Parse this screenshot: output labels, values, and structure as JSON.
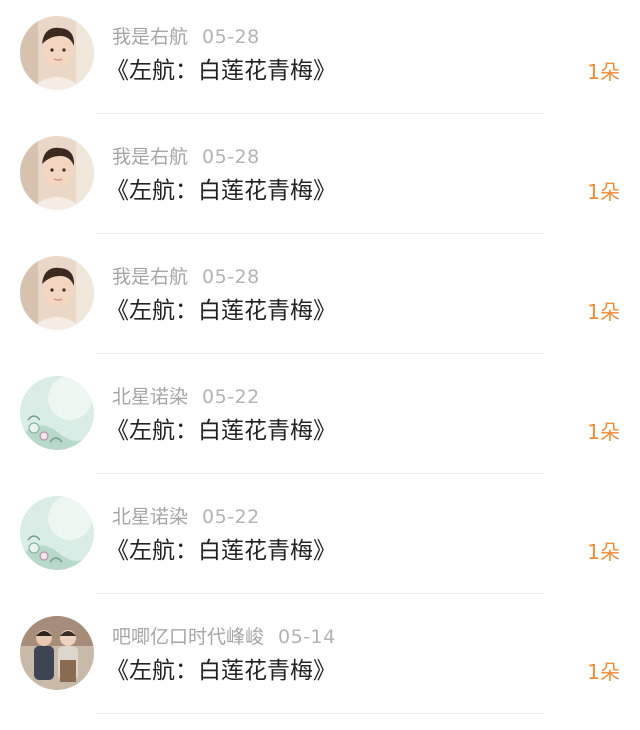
{
  "items": [
    {
      "username": "我是右航",
      "date": "05-28",
      "title": "《左航：白莲花青梅》",
      "count": "1朵",
      "avatar": "boy-portrait-avatar"
    },
    {
      "username": "我是右航",
      "date": "05-28",
      "title": "《左航：白莲花青梅》",
      "count": "1朵",
      "avatar": "boy-portrait-avatar"
    },
    {
      "username": "我是右航",
      "date": "05-28",
      "title": "《左航：白莲花青梅》",
      "count": "1朵",
      "avatar": "boy-portrait-avatar"
    },
    {
      "username": "北星诺染",
      "date": "05-22",
      "title": "《左航：白莲花青梅》",
      "count": "1朵",
      "avatar": "floral-teal-avatar"
    },
    {
      "username": "北星诺染",
      "date": "05-22",
      "title": "《左航：白莲花青梅》",
      "count": "1朵",
      "avatar": "floral-teal-avatar"
    },
    {
      "username": "吧唧亿口时代峰峻",
      "date": "05-14",
      "title": "《左航：白莲花青梅》",
      "count": "1朵",
      "avatar": "two-people-avatar"
    }
  ],
  "colors": {
    "count_accent": "#f08a3c",
    "username": "#a6a6a6",
    "title": "#222222"
  }
}
